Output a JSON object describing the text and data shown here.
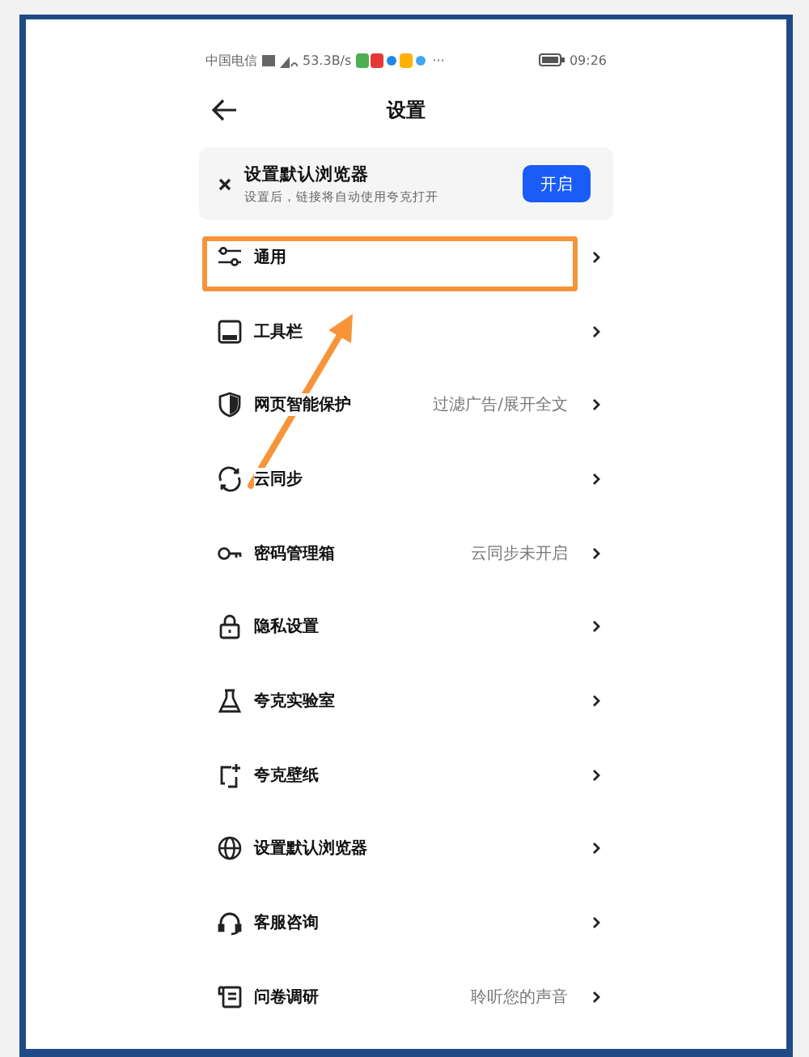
{
  "status_bar": {
    "carrier": "中国电信",
    "speed": "53.3B/s",
    "more": "···",
    "time": "09:26"
  },
  "header": {
    "title": "设置"
  },
  "banner": {
    "title": "设置默认浏览器",
    "subtitle": "设置后，链接将自动使用夸克打开",
    "button": "开启"
  },
  "items": [
    {
      "kind": "sliders",
      "label": "通用",
      "highlighted": true
    },
    {
      "kind": "toolbar",
      "label": "工具栏",
      "highlighted": false
    },
    {
      "kind": "shield",
      "label": "网页智能保护",
      "value": "过滤广告/展开全文",
      "highlighted": false
    },
    {
      "kind": "sync",
      "label": "云同步",
      "highlighted": false
    },
    {
      "kind": "key",
      "label": "密码管理箱",
      "value": "云同步未开启",
      "highlighted": false
    },
    {
      "kind": "lock",
      "label": "隐私设置",
      "highlighted": false
    },
    {
      "kind": "flask",
      "label": "夸克实验室",
      "highlighted": false
    },
    {
      "kind": "wallpaper",
      "label": "夸克壁纸",
      "highlighted": false
    },
    {
      "kind": "globe",
      "label": "设置默认浏览器",
      "highlighted": false
    },
    {
      "kind": "headset",
      "label": "客服咨询",
      "highlighted": false
    },
    {
      "kind": "survey",
      "label": "问卷调研",
      "value": "聆听您的声音",
      "highlighted": false
    }
  ],
  "annotation": {
    "kind": "arrow"
  }
}
